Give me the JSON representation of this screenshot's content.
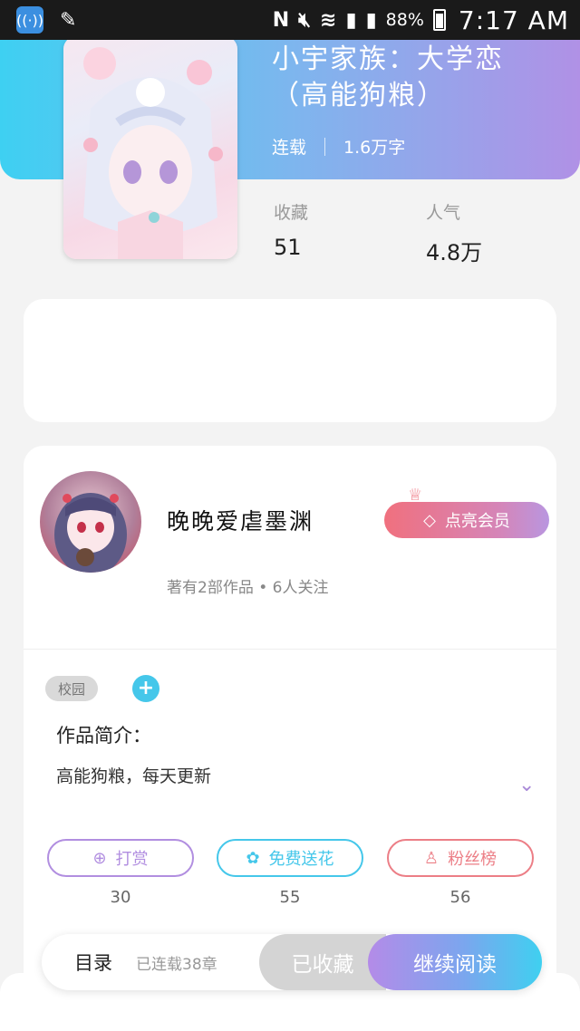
{
  "status_bar": {
    "battery": "88%",
    "time": "7:17 AM"
  },
  "book": {
    "title": "小宇家族：大学恋（高能狗粮）",
    "status": "连载",
    "word_count": "1.6万字",
    "stats": [
      {
        "label": "收藏",
        "value": "51"
      },
      {
        "label": "人气",
        "value": "4.8万"
      }
    ]
  },
  "author": {
    "name": "晚晚爱虐墨渊",
    "summary": "著有2部作品 • 6人关注",
    "vip_button": "点亮会员"
  },
  "tags": [
    "校园"
  ],
  "tag_add_symbol": "+",
  "intro": {
    "title": "作品简介：",
    "text": "高能狗粮，每天更新"
  },
  "actions": [
    {
      "label": "打赏",
      "icon": "yen-coin-icon",
      "count": "30",
      "color": "#b18ee0"
    },
    {
      "label": "免费送花",
      "icon": "flower-icon",
      "count": "55",
      "color": "#45c7ea"
    },
    {
      "label": "粉丝榜",
      "icon": "fan-user-icon",
      "count": "56",
      "color": "#ec7e86"
    }
  ],
  "bottom_bar": {
    "catalog": "目录",
    "serial_status": "已连载38章",
    "collected": "已收藏",
    "continue_reading": "继续阅读"
  }
}
